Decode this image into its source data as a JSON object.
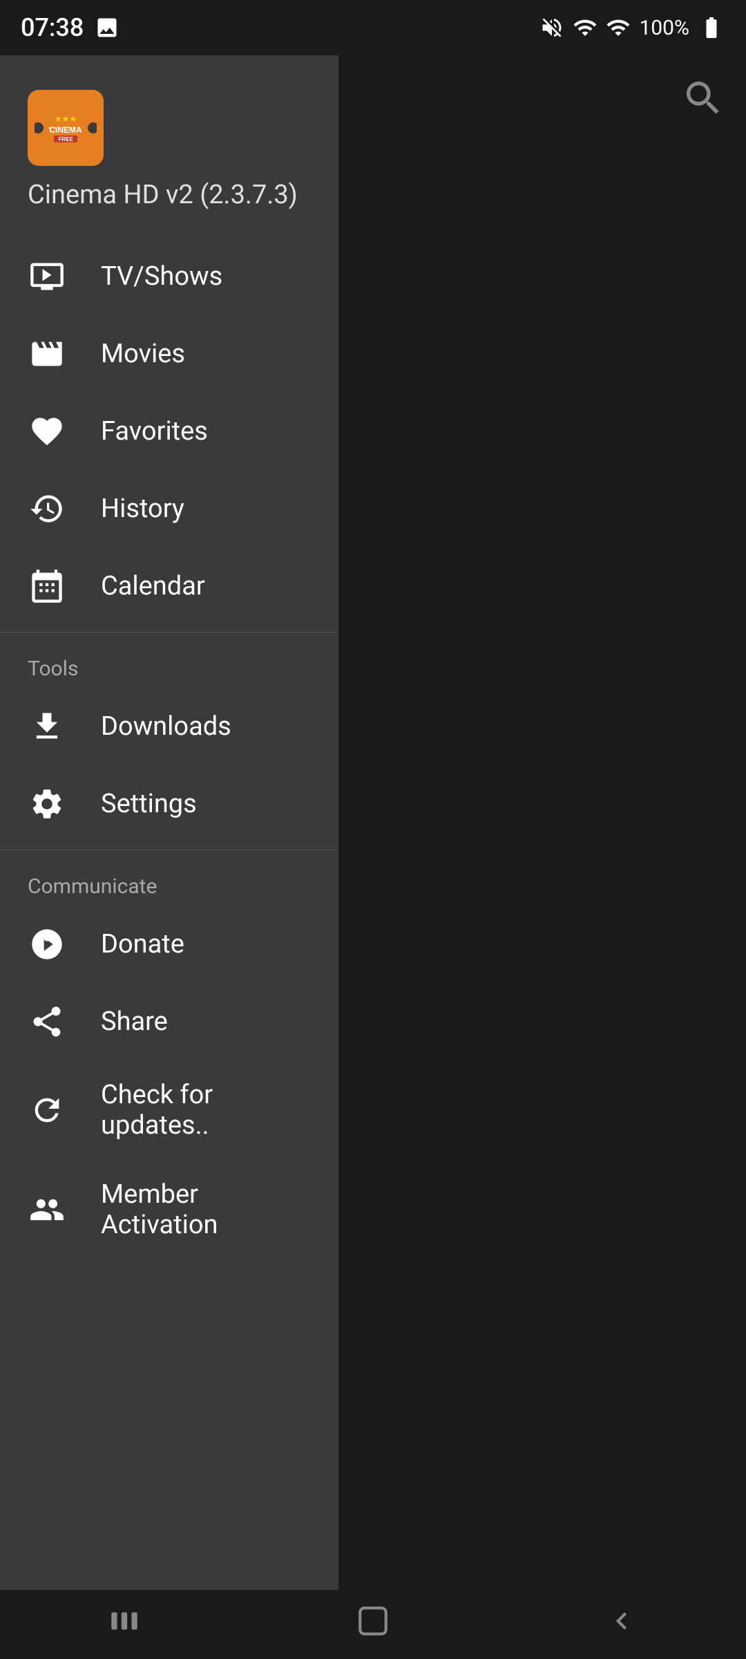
{
  "statusBar": {
    "time": "07:38",
    "battery": "100%",
    "batteryIcon": "🔋"
  },
  "app": {
    "logoText": "CINEMA",
    "logoStars": "★★★",
    "logoFree": "FREE",
    "title": "Cinema HD v2 (2.3.7.3)"
  },
  "nav": {
    "items": [
      {
        "id": "tv-shows",
        "label": "TV/Shows",
        "icon": "tv"
      },
      {
        "id": "movies",
        "label": "Movies",
        "icon": "movie"
      },
      {
        "id": "favorites",
        "label": "Favorites",
        "icon": "heart"
      },
      {
        "id": "history",
        "label": "History",
        "icon": "history"
      },
      {
        "id": "calendar",
        "label": "Calendar",
        "icon": "calendar"
      }
    ]
  },
  "toolsSection": {
    "header": "Tools",
    "items": [
      {
        "id": "downloads",
        "label": "Downloads",
        "icon": "download"
      },
      {
        "id": "settings",
        "label": "Settings",
        "icon": "settings"
      }
    ]
  },
  "communicateSection": {
    "header": "Communicate",
    "items": [
      {
        "id": "donate",
        "label": "Donate",
        "icon": "donate"
      },
      {
        "id": "share",
        "label": "Share",
        "icon": "share"
      },
      {
        "id": "check-updates",
        "label": "Check for updates..",
        "icon": "refresh"
      },
      {
        "id": "member-activation",
        "label": "Member Activation",
        "icon": "group"
      }
    ]
  },
  "search": {
    "icon": "search"
  },
  "bottomNav": {
    "menuIcon": "|||",
    "homeIcon": "⬜",
    "backIcon": "<"
  }
}
